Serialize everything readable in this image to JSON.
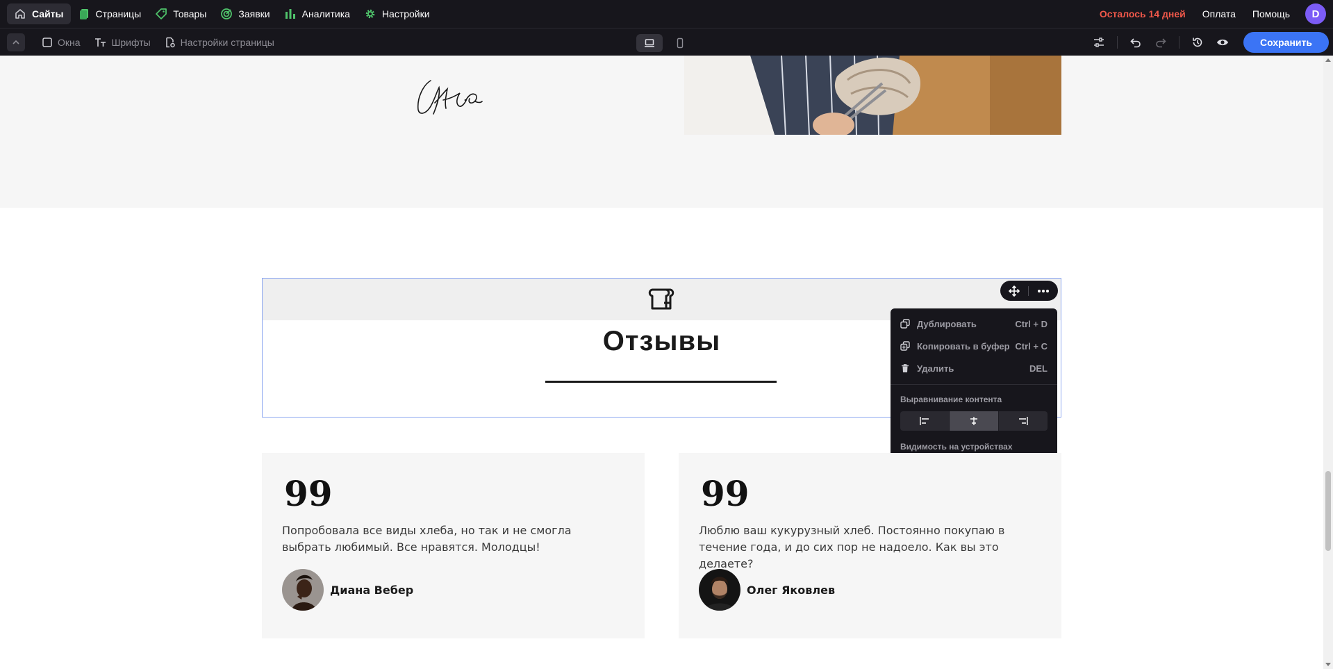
{
  "topnav": {
    "items": [
      {
        "label": "Сайты",
        "icon": "home-icon"
      },
      {
        "label": "Страницы",
        "icon": "pages-icon"
      },
      {
        "label": "Товары",
        "icon": "tag-icon"
      },
      {
        "label": "Заявки",
        "icon": "target-icon"
      },
      {
        "label": "Аналитика",
        "icon": "bar-chart-icon"
      },
      {
        "label": "Настройки",
        "icon": "gear-icon"
      }
    ],
    "trial_text": "Осталось 14 дней",
    "payment_label": "Оплата",
    "help_label": "Помощь",
    "avatar_letter": "D",
    "colors": {
      "trial": "#f0584a",
      "avatar": "#7c5cf6",
      "accent": "#3b74f5",
      "green_icons": "#4fc36b"
    }
  },
  "toolbar": {
    "windows_label": "Окна",
    "fonts_label": "Шрифты",
    "page_settings_label": "Настройки страницы",
    "save_label": "Сохранить"
  },
  "reviews_block": {
    "title": "Отзывы"
  },
  "context_menu": {
    "items": [
      {
        "label": "Дублировать",
        "shortcut": "Ctrl + D",
        "icon": "duplicate-icon"
      },
      {
        "label": "Копировать в буфер",
        "shortcut": "Ctrl + C",
        "icon": "copy-icon"
      },
      {
        "label": "Удалить",
        "shortcut": "DEL",
        "icon": "trash-icon"
      }
    ],
    "alignment_title": "Выравнивание контента",
    "visibility_title": "Видимость на устройствах",
    "alignment_selected": "center",
    "visibility_selected": "all-devices"
  },
  "reviews": [
    {
      "quote_mark": "99",
      "text": "Попробовала все виды хлеба, но так и не смогла выбрать любимый. Все нравятся. Молодцы!",
      "author": "Диана Вебер"
    },
    {
      "quote_mark": "99",
      "text": "Люблю ваш кукурузный хлеб. Постоянно покупаю в течение года, и до сих пор не надоело. Как вы это делаете?",
      "author": "Олег Яковлев"
    }
  ]
}
